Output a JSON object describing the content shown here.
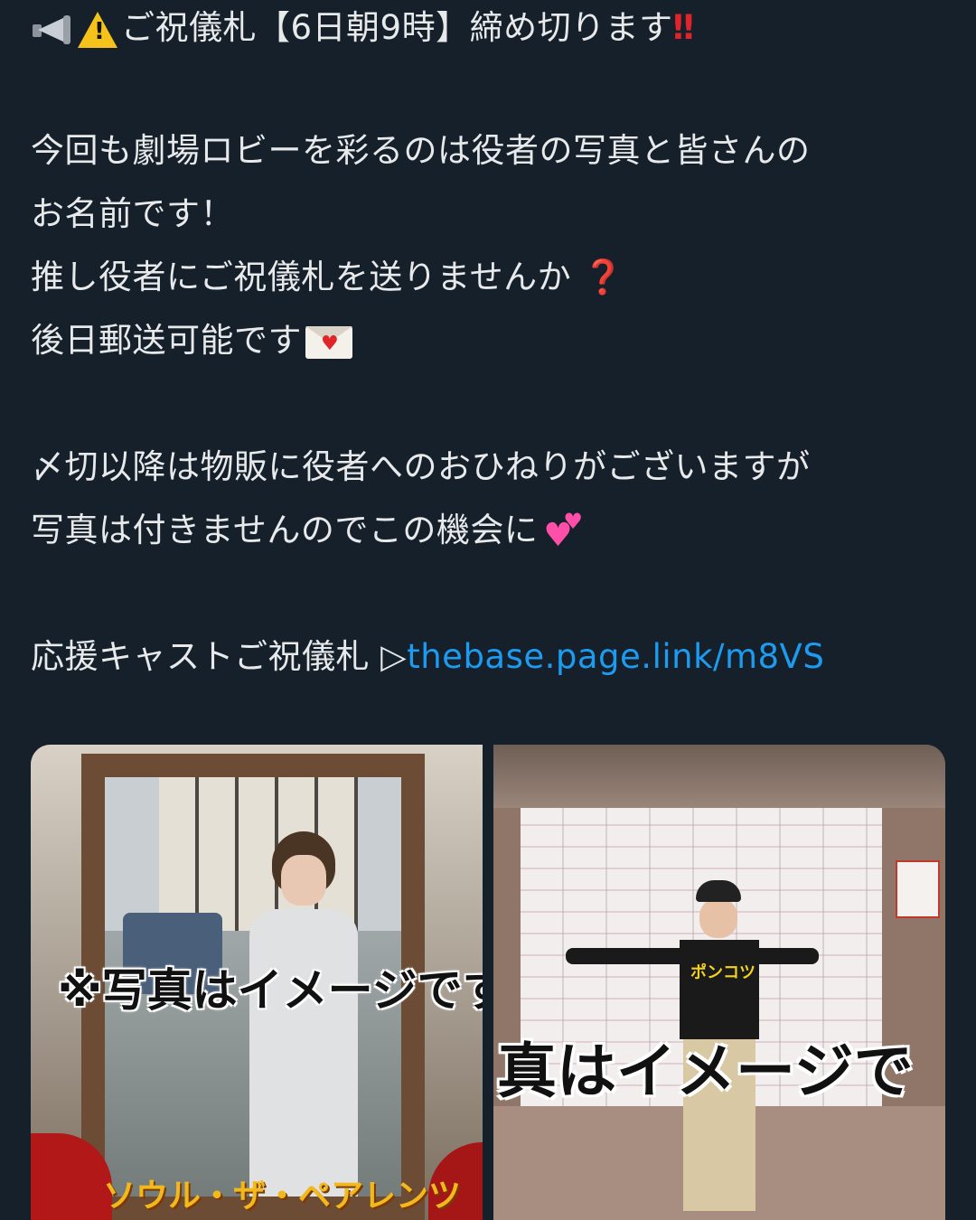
{
  "post": {
    "title_text": "ご祝儀札【6日朝9時】締め切ります",
    "title_emphasis": "‼",
    "para1_line1": "今回も劇場ロビーを彩るのは役者の写真と皆さんの",
    "para1_line2": "お名前です！",
    "para1_line3": "推し役者にご祝儀札を送りませんか",
    "para1_line3_mark": "❓",
    "para1_line4": "後日郵送可能です",
    "para2_line1": "〆切以降は物販に役者へのおひねりがございますが",
    "para2_line2": "写真は付きませんのでこの機会に",
    "link_label": "応援キャストご祝儀札 ▷",
    "link_url": "thebase.page.link/m8VS"
  },
  "images": {
    "left_caption": "※写真はイメージです。",
    "left_title": "ソウル・ザ・ペアレンツ",
    "right_caption": "真はイメージで",
    "right_shirt_text": "ポンコツ"
  },
  "icons": {
    "megaphone": "megaphone-icon",
    "warning": "warning-icon",
    "envelope": "envelope-heart-icon",
    "hearts": "two-hearts-icon"
  },
  "colors": {
    "background": "#16202b",
    "text": "#e7e9ea",
    "link": "#1d9bf0",
    "emphasis": "#e0242a"
  }
}
